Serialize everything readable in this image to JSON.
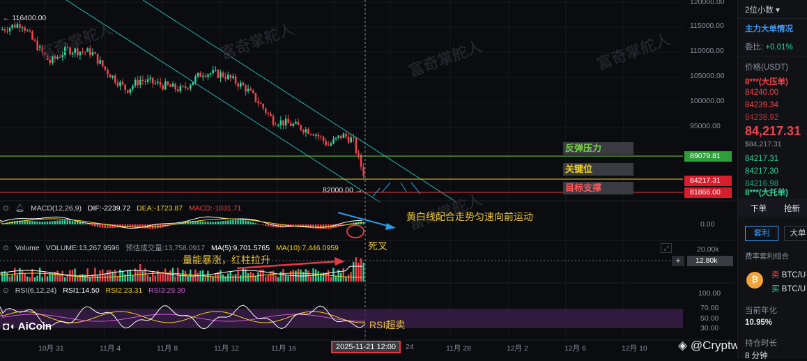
{
  "chart": {
    "high_marker": "116400.00",
    "low_marker": "82000.00",
    "y_ticks": [
      "120000.00",
      "115000.00",
      "110000.00",
      "105000.00",
      "100000.00",
      "95000.00"
    ],
    "x_ticks": [
      "10月 31",
      "11月 4",
      "11月 8",
      "11月 12",
      "11月 16",
      "24",
      "11月 28",
      "12月 2",
      "12月 6",
      "12月 10"
    ],
    "cursor_time": "2025-11-21 12:00",
    "watermark": "富奇掌舵人",
    "colors": {
      "up": "#2bd49a",
      "down": "#f0444c",
      "channel": "#1fb8b0",
      "bg": "#0b0c0f"
    }
  },
  "levels": {
    "resistance": {
      "label": "反弹压力",
      "price": "89079.81",
      "color": "#7ad14b"
    },
    "key": {
      "label": "关键位",
      "price": "84217.31",
      "color": "#f2d21c"
    },
    "support": {
      "label": "目标支撑",
      "price": "81866.00",
      "color": "#e23a45"
    }
  },
  "macd": {
    "title": "MACD(12,26,9)",
    "dif": "DIF:-2239.72",
    "dea": "DEA:-1723.87",
    "macd": "MACD:-1031.71",
    "zero_label": "0.00"
  },
  "volume": {
    "title": "Volume",
    "vol": "VOLUME:13,267.9596",
    "est": "预估成交量:13,758.0917",
    "ma5": "MA(5):9,701.5765",
    "ma10": "MA(10):7,446.0959",
    "tick_top": "20.00k",
    "tick_cur": "12.80k"
  },
  "rsi": {
    "title": "RSI(6,12,24)",
    "rsi1": "RSI1:14.50",
    "rsi2": "RSI2:23.31",
    "rsi3": "RSI3:29.30",
    "ticks": [
      "100.00",
      "70.00",
      "50.00",
      "30.00"
    ]
  },
  "annotations": {
    "trend": "黄白线配合走势匀速向前运动",
    "cross": "死叉",
    "volume": "量能暴涨，红柱拉升",
    "rsi": "RSI超卖"
  },
  "brand": {
    "logo": "AiCoin",
    "footer": "@Cryptw 奇"
  },
  "side": {
    "decimal": "2位小数",
    "section": "主力大单情况",
    "ratio_label": "委比:",
    "ratio_value": "+0.01%",
    "price_header": "价格(USDT)",
    "ask_big": "8***(大压单)",
    "asks": [
      "84240.00",
      "84239.34",
      "84238.92"
    ],
    "last_price": "84,217.31",
    "last_usd": "$84,217.31",
    "bids": [
      "84217.31",
      "84217.30",
      "84216.98"
    ],
    "bid_big": "8***(大托单)",
    "btn_down": "下单",
    "btn_grab": "抢新",
    "tab_arb": "套利",
    "tab_big": "大单",
    "funding_combo": "费率套利组合",
    "sell_label": "卖",
    "sell_pair": "BTC/U",
    "buy_label": "买",
    "buy_pair": "BTC/U",
    "annual_label": "当前年化",
    "annual_value": "10.95%",
    "hold_label": "持仓时长",
    "hold_value": "8",
    "hold_unit": "分钟"
  }
}
